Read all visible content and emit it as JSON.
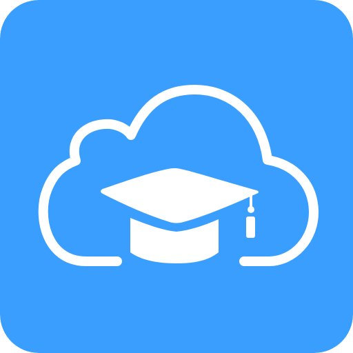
{
  "icon": {
    "name": "cloud-graduation-cap-icon",
    "background_color": "#3A9EFF",
    "foreground_color": "#FFFFFF"
  }
}
